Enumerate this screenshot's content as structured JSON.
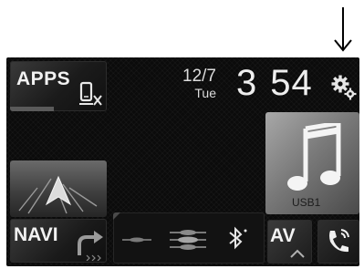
{
  "apps_button": {
    "label": "APPS",
    "icon": "phone-disconnected-icon"
  },
  "date": {
    "day": "12/7",
    "weekday": "Tue"
  },
  "clock": {
    "hours": "3",
    "minutes": "54"
  },
  "settings": {
    "icon": "gear-icon"
  },
  "navi_button": {
    "label": "NAVI",
    "icon": "navigation-arrow-icon"
  },
  "music_tile": {
    "source": "USB1",
    "icon": "music-note-icon"
  },
  "bottom_bar": {
    "icons": [
      "shortcut-icon",
      "shortcut-icon",
      "bluetooth-icon"
    ]
  },
  "av_button": {
    "label": "AV",
    "icon": "chevron-up-icon"
  },
  "phone_button": {
    "icon": "phone-icon"
  },
  "annotation": {
    "icon": "down-arrow-icon"
  },
  "colors": {
    "background": "#0b0b0b",
    "text": "#f2f2f2",
    "tile": "#1b1b1b"
  }
}
